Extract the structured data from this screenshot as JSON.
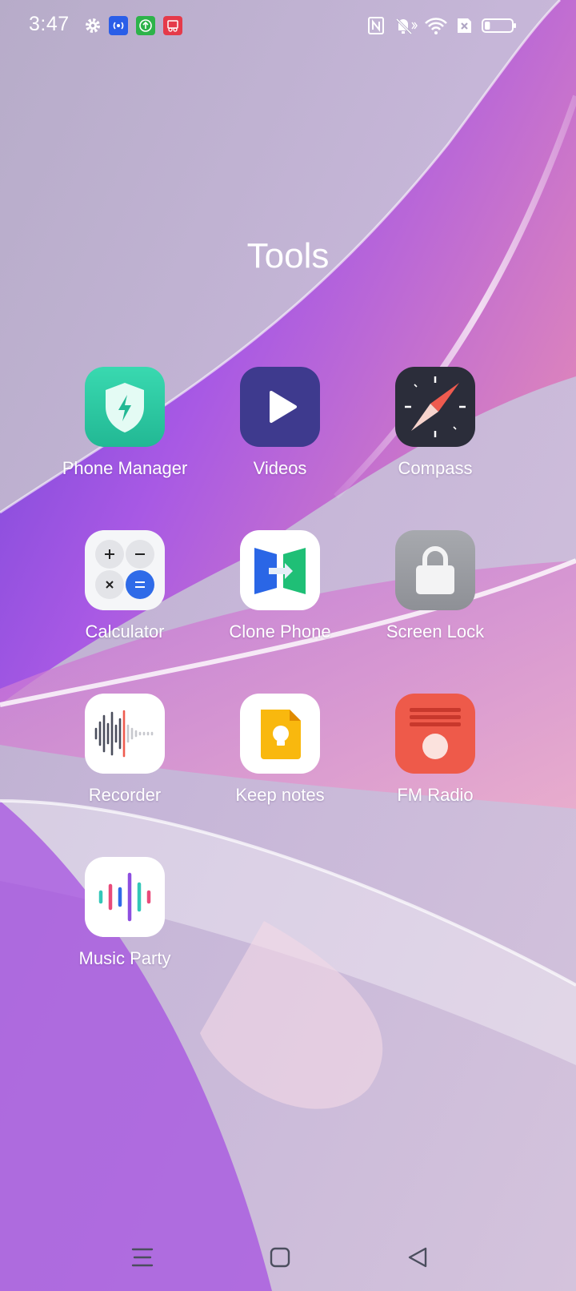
{
  "status_bar": {
    "time": "3:47",
    "icons": [
      "settings-icon",
      "hotspot-icon",
      "upload-icon",
      "screenshot-icon",
      "nfc-icon",
      "vibrate-icon",
      "wifi-icon",
      "no-sim-icon",
      "battery-icon"
    ],
    "battery_level": 0.2
  },
  "folder": {
    "title": "Tools"
  },
  "apps": [
    {
      "label": "Phone Manager",
      "icon": "shield-bolt-icon",
      "color": "#2fd3a8"
    },
    {
      "label": "Videos",
      "icon": "play-icon",
      "color": "#3d3a8c"
    },
    {
      "label": "Compass",
      "icon": "compass-icon",
      "color": "#2b2d3a"
    },
    {
      "label": "Calculator",
      "icon": "calculator-icon",
      "color": "#f5f6f8"
    },
    {
      "label": "Clone Phone",
      "icon": "clone-phone-icon",
      "color": "#ffffff"
    },
    {
      "label": "Screen Lock",
      "icon": "lock-icon",
      "color": "#9b9da3"
    },
    {
      "label": "Recorder",
      "icon": "waveform-icon",
      "color": "#ffffff"
    },
    {
      "label": "Keep notes",
      "icon": "note-bulb-icon",
      "color": "#ffffff"
    },
    {
      "label": "FM Radio",
      "icon": "radio-icon",
      "color": "#ee5a4a"
    },
    {
      "label": "Music Party",
      "icon": "music-bars-icon",
      "color": "#ffffff"
    }
  ],
  "nav": {
    "icons": [
      "menu-icon",
      "home-icon",
      "back-icon"
    ]
  }
}
